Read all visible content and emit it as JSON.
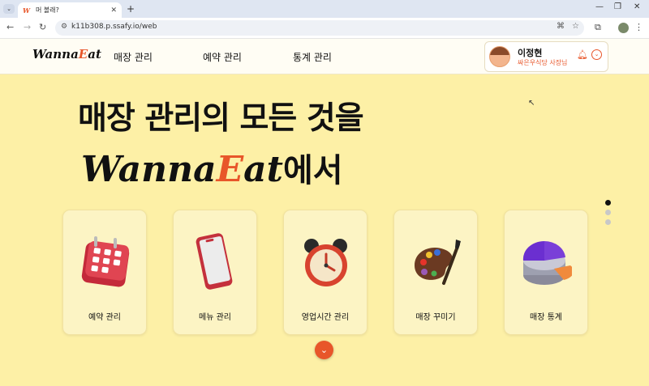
{
  "browser": {
    "tab_title": "머 볼래?",
    "tab_favicon": "W",
    "url": "k11b308.p.ssafy.io/web"
  },
  "app": {
    "logo_main": "Wanna",
    "logo_accent": "E",
    "logo_tail": "at",
    "nav": [
      "매장 관리",
      "예약 관리",
      "통계 관리"
    ],
    "user": {
      "name": "이정현",
      "shop": "싸은우식당 사장님"
    }
  },
  "hero": {
    "line1": "매장 관리의 모든 것을",
    "brand_main": "Wanna",
    "brand_accent": "E",
    "brand_tail": "at",
    "suffix": "에서"
  },
  "cards": [
    {
      "label": "예약 관리",
      "icon": "calendar-icon"
    },
    {
      "label": "메뉴 관리",
      "icon": "phone-icon"
    },
    {
      "label": "영업시간 관리",
      "icon": "alarm-clock-icon"
    },
    {
      "label": "매장 꾸미기",
      "icon": "palette-icon"
    },
    {
      "label": "매장 통계",
      "icon": "pie-chart-icon"
    }
  ],
  "pager": {
    "total": 3,
    "active": 0
  },
  "colors": {
    "accent": "#e8562a",
    "background": "#fdf0a6",
    "card": "#fcf4c4"
  }
}
